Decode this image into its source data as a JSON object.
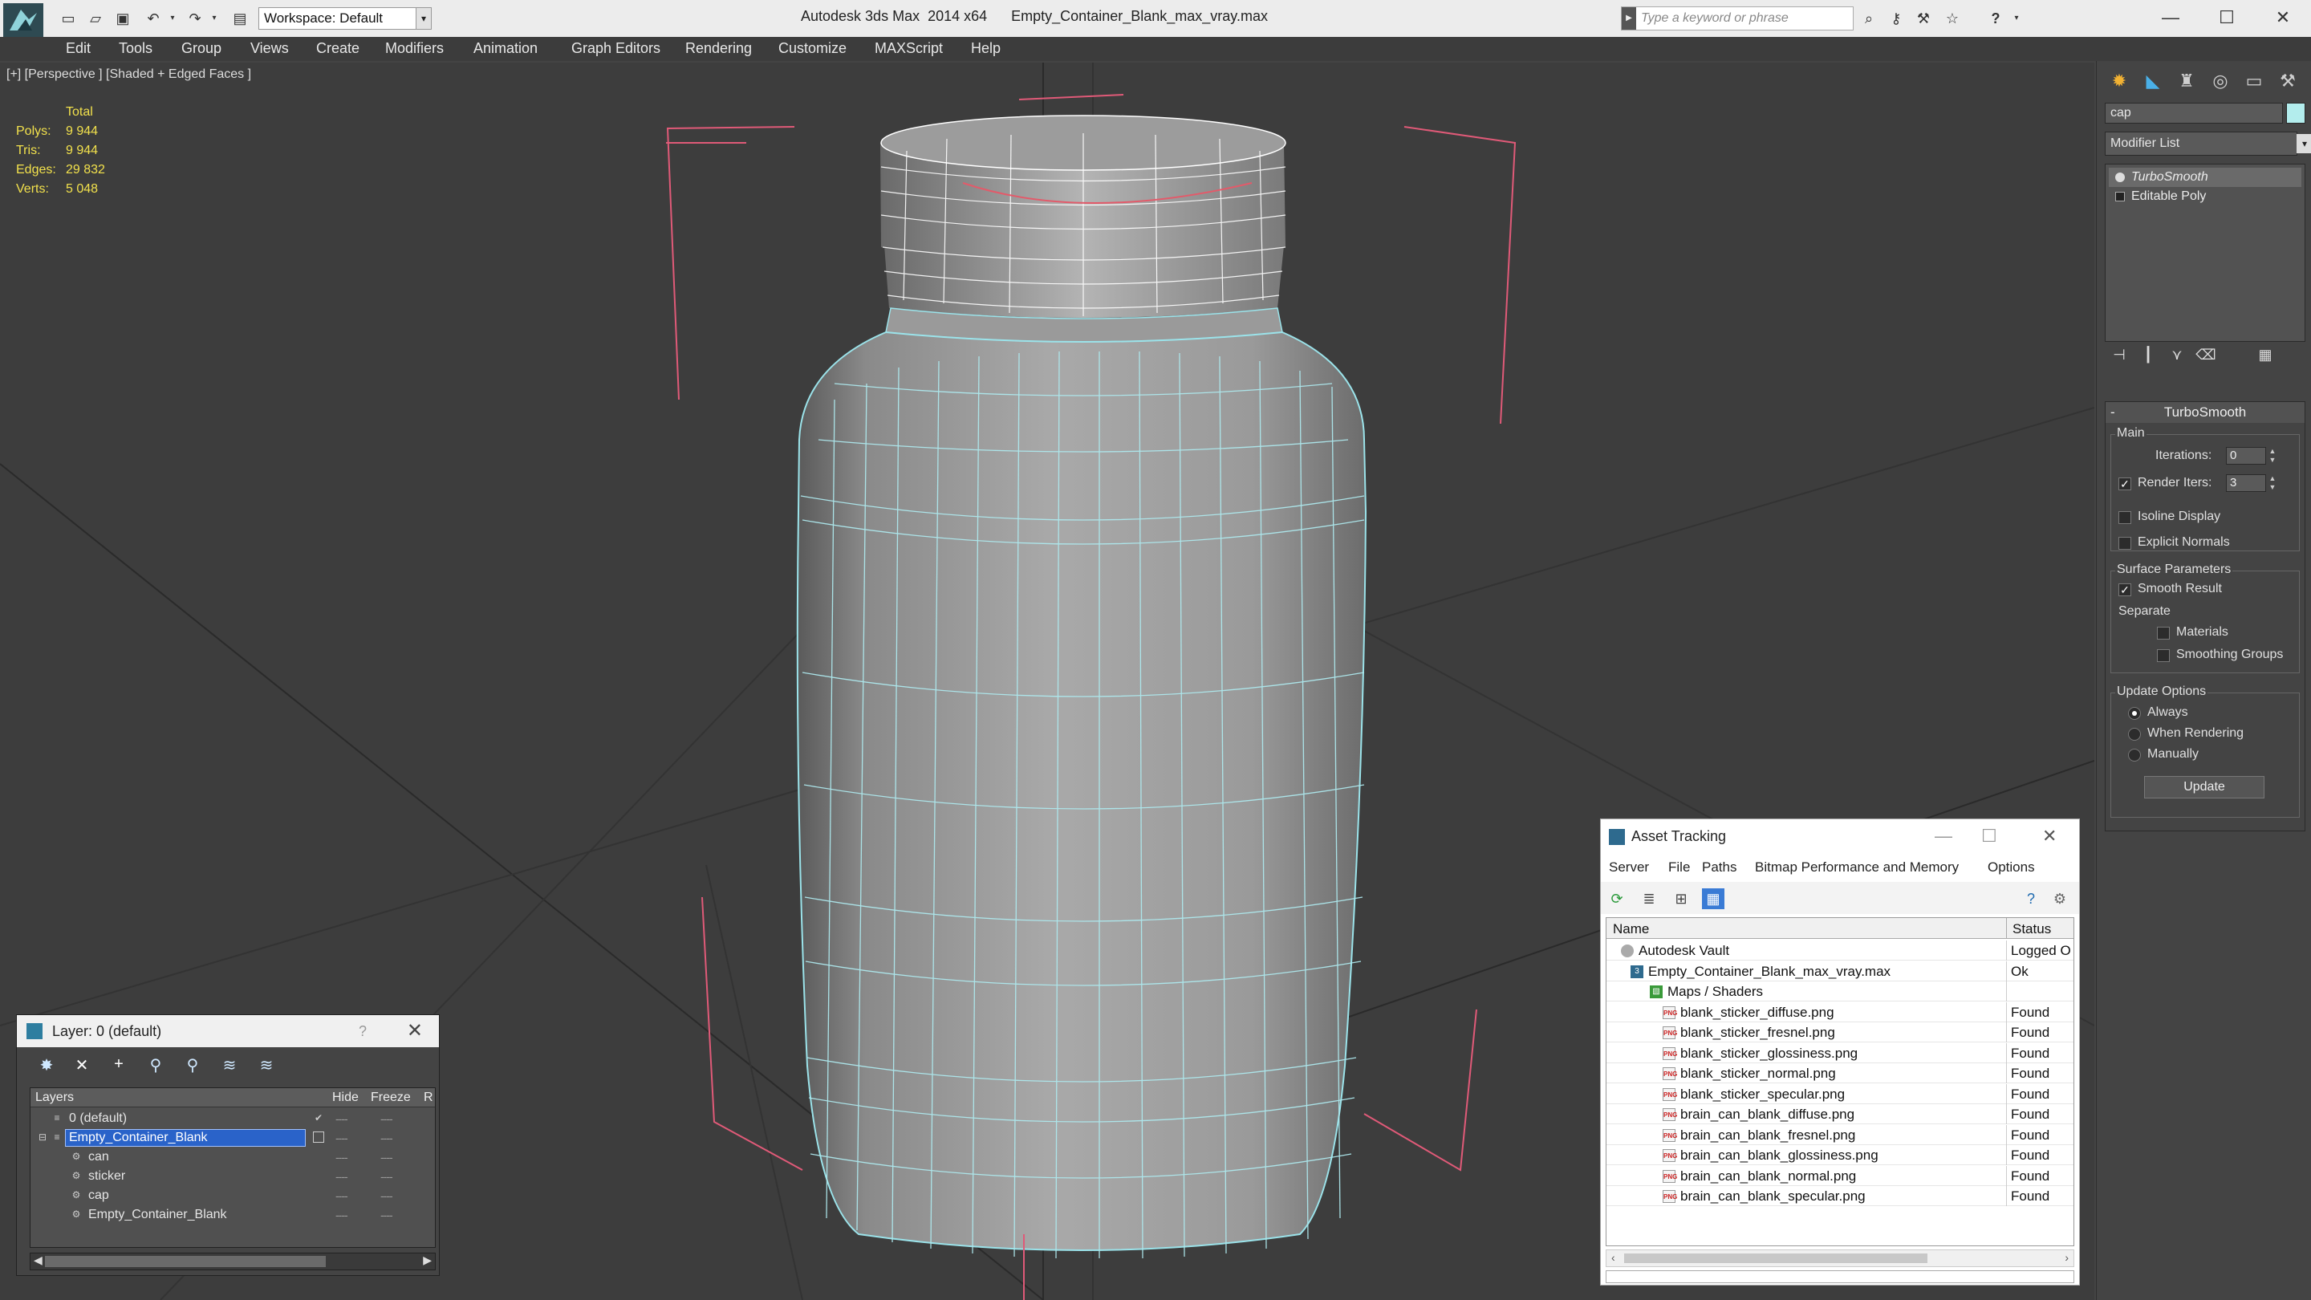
{
  "titlebar": {
    "title": "Autodesk 3ds Max  2014 x64      Empty_Container_Blank_max_vray.max",
    "workspace": "Workspace: Default",
    "search_placeholder": "Type a keyword or phrase",
    "minimize": "—",
    "maximize": "☐",
    "close": "✕"
  },
  "menu": [
    "Edit",
    "Tools",
    "Group",
    "Views",
    "Create",
    "Modifiers",
    "Animation",
    "Graph Editors",
    "Rendering",
    "Customize",
    "MAXScript",
    "Help"
  ],
  "viewport": {
    "label": "[+] [Perspective ] [Shaded + Edged Faces ]",
    "stats": {
      "header": "Total",
      "rows": [
        {
          "k": "Polys:",
          "v": "9 944"
        },
        {
          "k": "Tris:",
          "v": "9 944"
        },
        {
          "k": "Edges:",
          "v": "29 832"
        },
        {
          "k": "Verts:",
          "v": "5 048"
        }
      ]
    }
  },
  "command_panel": {
    "object_name": "cap",
    "object_color": "#b3eded",
    "modifier_list": "Modifier List",
    "stack": [
      "TurboSmooth",
      "Editable Poly"
    ],
    "rollout": {
      "title": "TurboSmooth",
      "main_label": "Main",
      "iterations_label": "Iterations:",
      "iterations": "0",
      "render_iters_label": "Render Iters:",
      "render_iters": "3",
      "render_iters_checked": true,
      "isoline": "Isoline Display",
      "explicit_normals": "Explicit Normals",
      "surface_params": "Surface Parameters",
      "smooth_result": "Smooth Result",
      "separate": "Separate",
      "materials": "Materials",
      "smoothing_groups": "Smoothing Groups",
      "update_options": "Update Options",
      "always": "Always",
      "when_rendering": "When Rendering",
      "manually": "Manually",
      "update_button": "Update"
    }
  },
  "layer_dialog": {
    "title": "Layer: 0 (default)",
    "help": "?",
    "close": "✕",
    "columns": {
      "layers": "Layers",
      "hide": "Hide",
      "freeze": "Freeze",
      "r": "R"
    },
    "rows": [
      {
        "name": "0 (default)",
        "indent": 0,
        "check": "✔",
        "dash1": "----",
        "dash2": "----"
      },
      {
        "name": "Empty_Container_Blank",
        "indent": 0,
        "selected": true,
        "dash1": "----",
        "dash2": "----"
      },
      {
        "name": "can",
        "indent": 1,
        "dash1": "----",
        "dash2": "----"
      },
      {
        "name": "sticker",
        "indent": 1,
        "dash1": "----",
        "dash2": "----"
      },
      {
        "name": "cap",
        "indent": 1,
        "dash1": "----",
        "dash2": "----"
      },
      {
        "name": "Empty_Container_Blank",
        "indent": 1,
        "dash1": "----",
        "dash2": "----"
      }
    ]
  },
  "asset_dialog": {
    "title": "Asset Tracking",
    "minimize": "—",
    "maximize": "☐",
    "close": "✕",
    "menu": [
      "Server",
      "File",
      "Paths",
      "Bitmap Performance and Memory",
      "Options"
    ],
    "columns": {
      "name": "Name",
      "status": "Status"
    },
    "rows": [
      {
        "name": "Autodesk Vault",
        "status": "Logged O",
        "indent": 0,
        "icon": "vault"
      },
      {
        "name": "Empty_Container_Blank_max_vray.max",
        "status": "Ok",
        "indent": 1,
        "icon": "max"
      },
      {
        "name": "Maps / Shaders",
        "status": "",
        "indent": 2,
        "icon": "maps"
      },
      {
        "name": "blank_sticker_diffuse.png",
        "status": "Found",
        "indent": 3,
        "icon": "png"
      },
      {
        "name": "blank_sticker_fresnel.png",
        "status": "Found",
        "indent": 3,
        "icon": "png"
      },
      {
        "name": "blank_sticker_glossiness.png",
        "status": "Found",
        "indent": 3,
        "icon": "png"
      },
      {
        "name": "blank_sticker_normal.png",
        "status": "Found",
        "indent": 3,
        "icon": "png"
      },
      {
        "name": "blank_sticker_specular.png",
        "status": "Found",
        "indent": 3,
        "icon": "png"
      },
      {
        "name": "brain_can_blank_diffuse.png",
        "status": "Found",
        "indent": 3,
        "icon": "png"
      },
      {
        "name": "brain_can_blank_fresnel.png",
        "status": "Found",
        "indent": 3,
        "icon": "png"
      },
      {
        "name": "brain_can_blank_glossiness.png",
        "status": "Found",
        "indent": 3,
        "icon": "png"
      },
      {
        "name": "brain_can_blank_normal.png",
        "status": "Found",
        "indent": 3,
        "icon": "png"
      },
      {
        "name": "brain_can_blank_specular.png",
        "status": "Found",
        "indent": 3,
        "icon": "png"
      }
    ]
  }
}
